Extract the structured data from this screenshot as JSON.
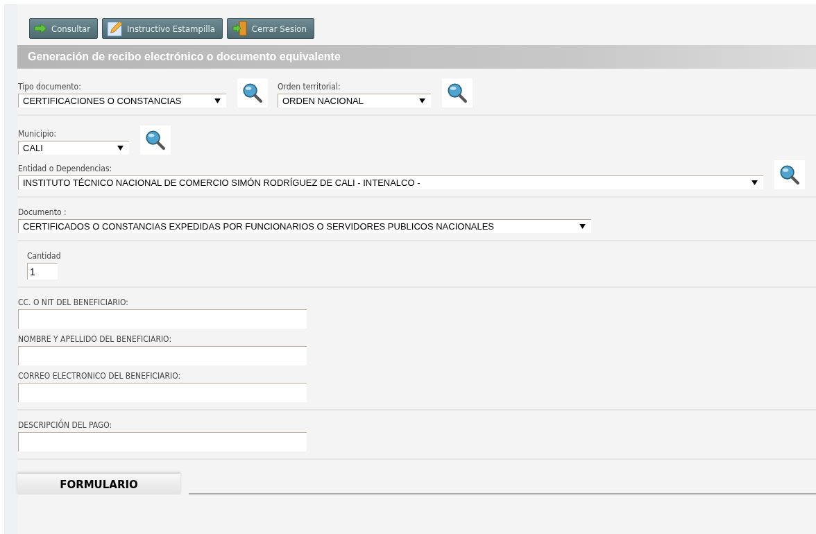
{
  "toolbar": [
    {
      "kind": "arrow",
      "label": "Consultar"
    },
    {
      "kind": "pencil",
      "label": "Instructivo Estampilla"
    },
    {
      "kind": "exit",
      "label": "Cerrar Sesion"
    }
  ],
  "header": {
    "title": "Generación de recibo electrónico o documento equivalente"
  },
  "sections": [
    {
      "fields": [
        {
          "kind": "select",
          "label": "Tipo documento:",
          "value": "CERTIFICACIONES O CONSTANCIAS",
          "lookup": true
        },
        {
          "kind": "select",
          "label": "Orden territorial:",
          "value": "ORDEN NACIONAL",
          "lookup": true
        }
      ]
    },
    {
      "fields": [
        {
          "kind": "select",
          "label": "Municipio:",
          "value": "CALI",
          "lookup": true
        }
      ]
    },
    {
      "fields": [
        {
          "kind": "select",
          "label": "Entidad o Dependencias:",
          "value": "INSTITUTO TÉCNICO NACIONAL DE COMERCIO SIMÓN RODRÍGUEZ DE CALI - INTENALCO -",
          "lookup": true
        }
      ]
    },
    {
      "fields": [
        {
          "kind": "select",
          "label": "Documento :",
          "value": "CERTIFICADOS O CONSTANCIAS EXPEDIDAS POR FUNCIONARIOS O SERVIDORES PUBLICOS NACIONALES",
          "lookup": false
        }
      ]
    },
    {
      "fields": [
        {
          "kind": "number",
          "label": "Cantidad",
          "value": "1"
        }
      ]
    },
    {
      "fields": [
        {
          "kind": "text",
          "label": "CC. O NIT DEL BENEFICIARIO:"
        },
        {
          "kind": "text",
          "label": "NOMBRE Y APELLIDO DEL BENEFICIARIO:"
        },
        {
          "kind": "text",
          "label": "CORREO ELECTRONICO DEL BENEFICIARIO:"
        }
      ]
    },
    {
      "fields": [
        {
          "kind": "text",
          "label": "DESCRIPCIÓN DEL PAGO:"
        }
      ]
    }
  ],
  "tabs": [
    {
      "label": "FORMULARIO",
      "selected": true
    }
  ]
}
